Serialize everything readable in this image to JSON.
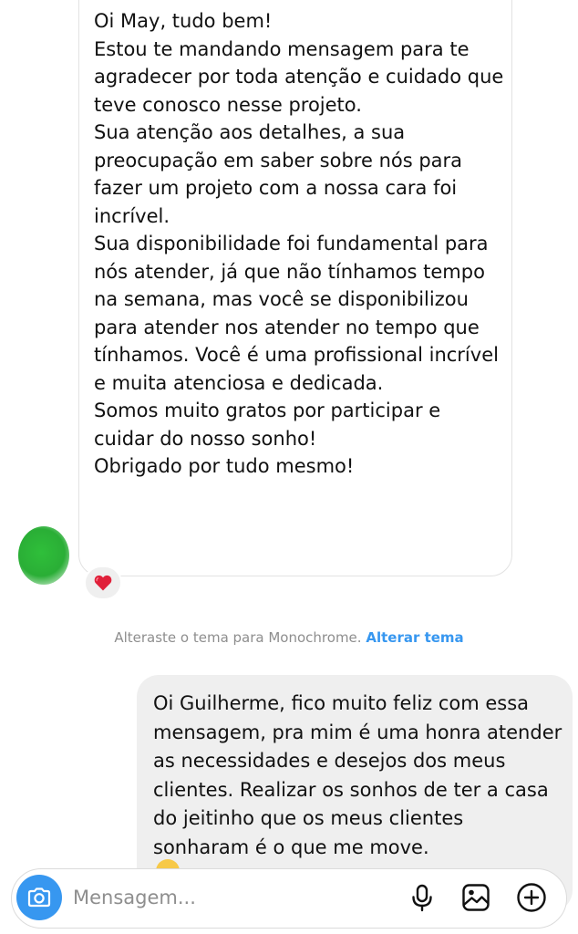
{
  "incoming": {
    "paragraphs": [
      "Oi May, tudo bem!",
      "Estou te mandando mensagem para te agradecer por toda atenção e cuidado que teve conosco nesse projeto.",
      "Sua atenção aos detalhes, a sua preocupação em saber sobre nós para fazer um projeto com a nossa cara foi incrível.",
      "Sua disponibilidade foi fundamental para nós atender, já que não tínhamos tempo na semana, mas você se disponibilizou para atender nos atender no tempo que tínhamos. Você é uma profissional incrível e muita atenciosa e dedicada.",
      "Somos muito gratos por participar e cuidar do nosso sonho!",
      "Obrigado por tudo mesmo!"
    ],
    "reaction": "heart",
    "avatar_color": "#2fbf3a"
  },
  "system_message": {
    "text": "Alteraste o tema para Monochrome.",
    "link": "Alterar tema"
  },
  "outgoing": {
    "text": "Oi Guilherme, fico muito feliz com essa mensagem, pra mim é uma honra atender as necessidades e desejos dos meus clientes. Realizar os sonhos de ter a casa do jeitinho que os meus clientes sonharam é o que me move."
  },
  "composer": {
    "placeholder": "Mensagem...",
    "icons": [
      "camera-icon",
      "microphone-icon",
      "gallery-icon",
      "add-icon"
    ]
  },
  "colors": {
    "accent": "#3797f0",
    "incoming_bubble_border": "#e2e2e2",
    "outgoing_bubble": "#efefef",
    "reaction_heart": "#e0203a"
  }
}
